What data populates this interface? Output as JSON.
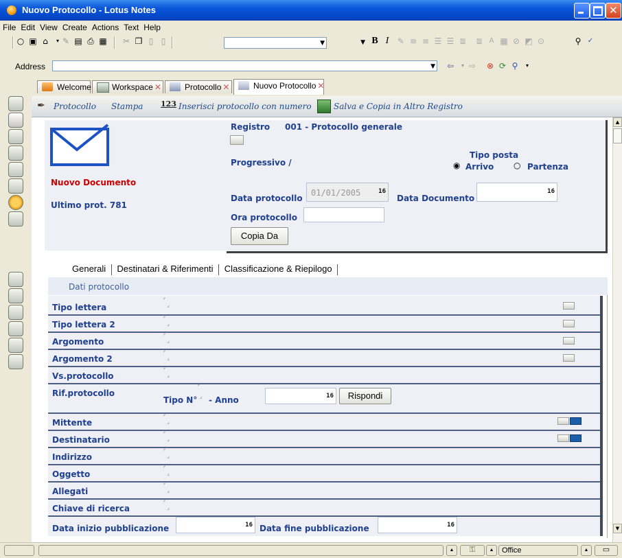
{
  "window": {
    "title": "Nuovo Protocollo - Lotus Notes"
  },
  "menu": [
    "File",
    "Edit",
    "View",
    "Create",
    "Actions",
    "Text",
    "Help"
  ],
  "address": {
    "label": "Address",
    "value": ""
  },
  "tabs": [
    {
      "label": "Welcome"
    },
    {
      "label": "Workspace"
    },
    {
      "label": "Protocollo"
    },
    {
      "label": "Nuovo Protocollo"
    }
  ],
  "actions": {
    "protocollo": "Protocollo",
    "stampa": "Stampa",
    "inserisci": "Inserisci protocollo con numero",
    "salva": "Salva e Copia in Altro Registro"
  },
  "header": {
    "nuovo_documento": "Nuovo Documento",
    "ultimo_prot": "Ultimo prot. 781",
    "registro_label": "Registro",
    "registro_value": "001 - Protocollo generale",
    "progressivo": "Progressivo /",
    "tipo_posta_label": "Tipo posta",
    "arrivo": "Arrivo",
    "partenza": "Partenza",
    "data_protocollo_label": "Data protocollo",
    "data_protocollo_value": "01/01/2005",
    "data_documento_label": "Data Documento",
    "ora_protocollo_label": "Ora protocollo",
    "copia_da": "Copia Da",
    "cal_label": "16"
  },
  "inner_tabs": [
    "Generali",
    "Destinatari & Riferimenti",
    "Classificazione & Riepilogo"
  ],
  "section_title": "Dati protocollo",
  "fields": {
    "tipo_lettera": "Tipo lettera",
    "tipo_lettera_2": "Tipo lettera 2",
    "argomento": "Argomento",
    "argomento_2": "Argomento 2",
    "vs_protocollo": "Vs.protocollo",
    "rif_protocollo": "Rif.protocollo",
    "tipo_n": "Tipo N°",
    "anno": "- Anno",
    "rispondi": "Rispondi",
    "mittente": "Mittente",
    "destinatario": "Destinatario",
    "indirizzo": "Indirizzo",
    "oggetto": "Oggetto",
    "allegati": "Allegati",
    "chiave_ricerca": "Chiave di ricerca",
    "data_inizio": "Data inizio pubblicazione",
    "data_fine": "Data fine pubblicazione"
  },
  "status": {
    "location": "Office"
  }
}
